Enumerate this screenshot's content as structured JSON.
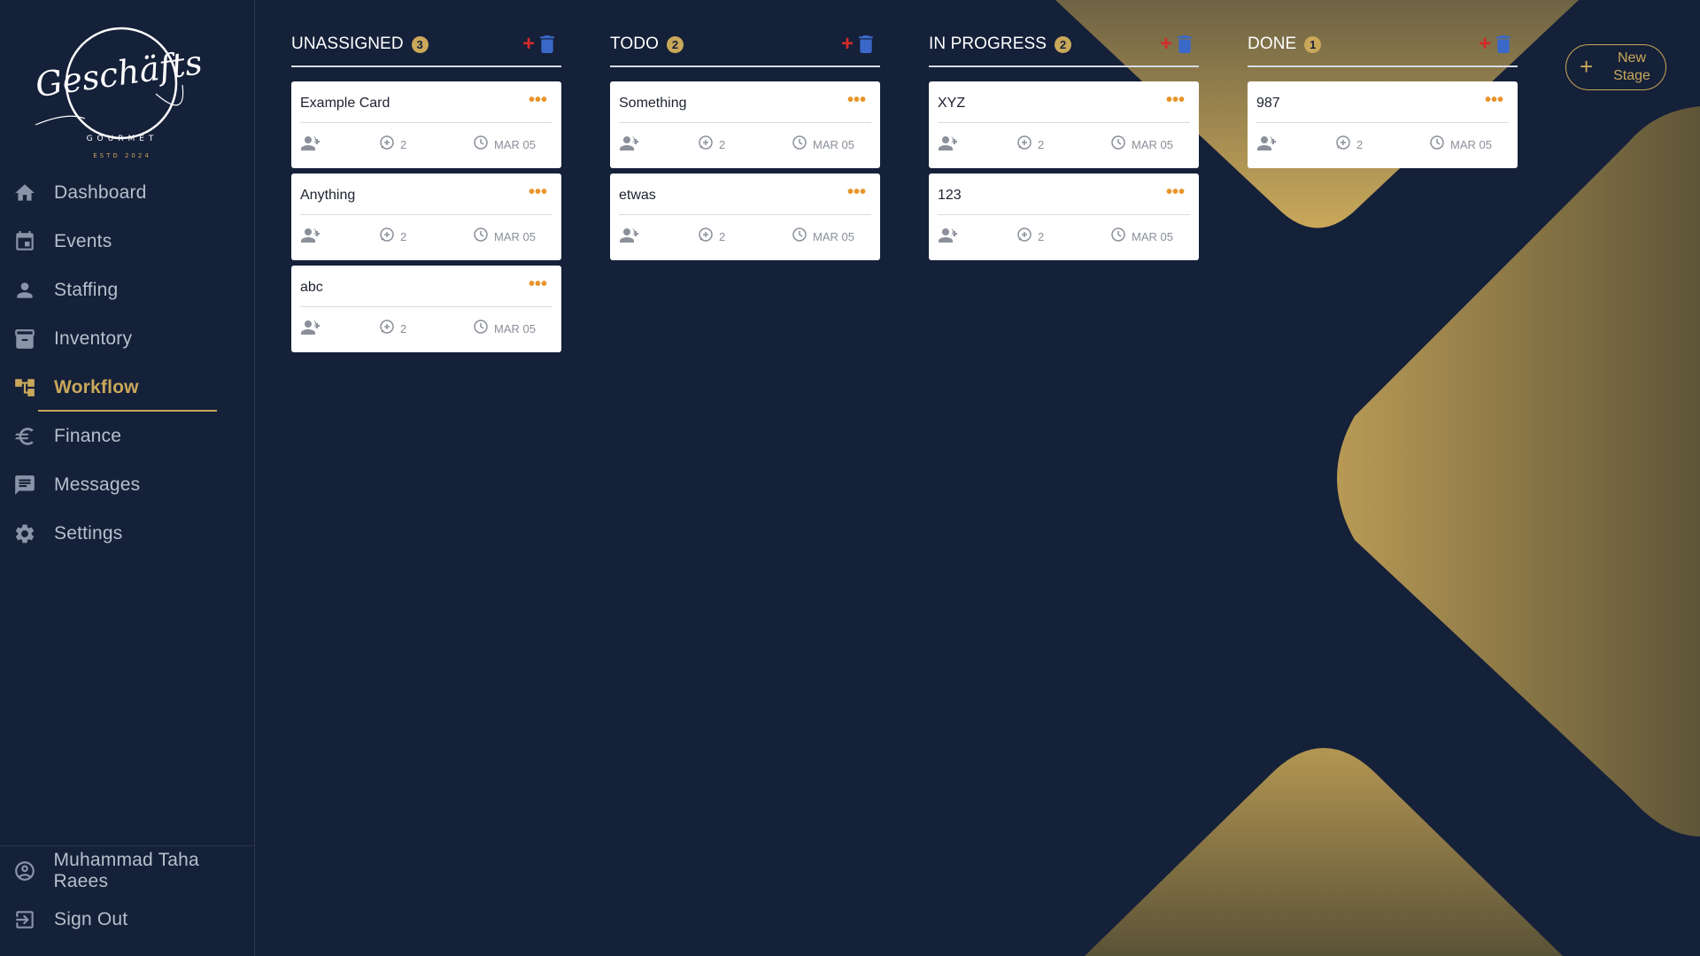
{
  "sidebar": {
    "brand": "Geschäfts",
    "brand_sub": "GOURMET",
    "brand_est": "ESTD 2024",
    "items": [
      {
        "label": "Dashboard",
        "icon": "home-icon"
      },
      {
        "label": "Events",
        "icon": "calendar-icon"
      },
      {
        "label": "Staffing",
        "icon": "person-icon"
      },
      {
        "label": "Inventory",
        "icon": "archive-icon"
      },
      {
        "label": "Workflow",
        "icon": "workflow-icon",
        "active": true
      },
      {
        "label": "Finance",
        "icon": "euro-icon"
      },
      {
        "label": "Messages",
        "icon": "message-icon"
      },
      {
        "label": "Settings",
        "icon": "gear-icon"
      }
    ],
    "user": {
      "label": "Muhammad Taha Raees",
      "icon": "account-circle-icon"
    },
    "signout": {
      "label": "Sign Out",
      "icon": "sign-out-icon"
    }
  },
  "board": {
    "columns": [
      {
        "title": "UNASSIGNED",
        "count": "3",
        "cards": [
          {
            "title": "Example Card",
            "comments": "2",
            "date": "MAR 05"
          },
          {
            "title": "Anything",
            "comments": "2",
            "date": "MAR 05"
          },
          {
            "title": "abc",
            "comments": "2",
            "date": "MAR 05"
          }
        ]
      },
      {
        "title": "TODO",
        "count": "2",
        "cards": [
          {
            "title": "Something",
            "comments": "2",
            "date": "MAR 05"
          },
          {
            "title": "etwas",
            "comments": "2",
            "date": "MAR 05"
          }
        ]
      },
      {
        "title": "IN PROGRESS",
        "count": "2",
        "cards": [
          {
            "title": "XYZ",
            "comments": "2",
            "date": "MAR 05"
          },
          {
            "title": "123",
            "comments": "2",
            "date": "MAR 05"
          }
        ]
      },
      {
        "title": "DONE",
        "count": "1",
        "cards": [
          {
            "title": "987",
            "comments": "2",
            "date": "MAR 05"
          }
        ]
      }
    ],
    "card_menu": "•••",
    "add_label": "+",
    "new_stage": {
      "line1": "New",
      "line2": "Stage",
      "plus": "+"
    }
  },
  "colors": {
    "background": "#152039",
    "accent_gold": "#c9a85a",
    "add_red": "#d42a2a",
    "trash_blue": "#3a68c9",
    "menu_orange": "#e8952a"
  }
}
